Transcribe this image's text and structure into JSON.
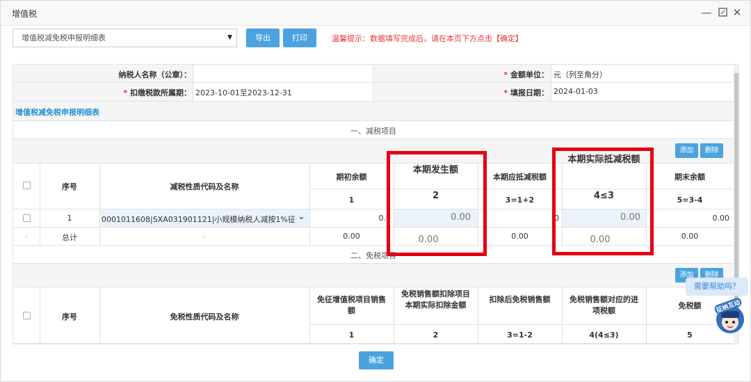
{
  "window": {
    "title": "增值税"
  },
  "toolbar": {
    "report_select": "增值税减免税申报明细表",
    "export_label": "导出",
    "print_label": "打印",
    "tip": "温馨提示：数据填写完成后，请在本页下方点击【确定】"
  },
  "info": {
    "taxpayer_label": "纳税人名称（公章）：",
    "taxpayer_value": "",
    "unit_label": "金额单位：",
    "unit_value": "元（列至角分）",
    "period_label": "扣缴税款所属期：",
    "period_value": "2023-10-01至2023-12-31",
    "fill_date_label": "填报日期：",
    "fill_date_value": "2024-01-03",
    "star": "*"
  },
  "table_title": "增值税减免税申报明细表",
  "section1": {
    "title": "一、减税项目",
    "add_label": "添加",
    "delete_label": "删除",
    "headers": {
      "seq": "序号",
      "code": "减税性质代码及名称",
      "c1": "期初余额",
      "c2": "本期发生额",
      "c3": "本期应抵减税额",
      "c4": "本期实际抵减税额",
      "c5": "期末余额"
    },
    "formulas": {
      "c1": "1",
      "c2": "2",
      "c3": "3=1+2",
      "c4": "4≤3",
      "c5": "5=3-4"
    },
    "row": {
      "seq": "1",
      "code": "0001011608|SXA031901121|小规模纳税人减按1%征收",
      "c1": "0.0",
      "c2": "0.00",
      "c3": "0",
      "c4": "0.00",
      "c5": "0.00"
    },
    "total": {
      "dash": "-",
      "label": "总计",
      "code": "-",
      "c1": "0.00",
      "c2": "0.00",
      "c3": "0.00",
      "c4": "0.00",
      "c5": "0.00"
    }
  },
  "section2": {
    "title": "二、免税项目",
    "add_label": "添加",
    "delete_label": "删除",
    "headers": {
      "seq": "序号",
      "code": "免税性质代码及名称",
      "c1": "免征增值税项目销售额",
      "c2": "免税销售额扣除项目本期实际扣除金额",
      "c3": "扣除后免税销售额",
      "c4": "免税销售额对应的进项税额",
      "c5": "免税额"
    },
    "formulas": {
      "c1": "1",
      "c2": "2",
      "c3": "3=1-2",
      "c4": "4(4≤3)",
      "c5": "5"
    }
  },
  "confirm_label": "确定",
  "help": {
    "bubble": "需要帮助吗？",
    "badge": "征纳互动"
  },
  "colors": {
    "accent": "#4aa3df",
    "alert": "#e60012",
    "tip": "#e8343a"
  }
}
